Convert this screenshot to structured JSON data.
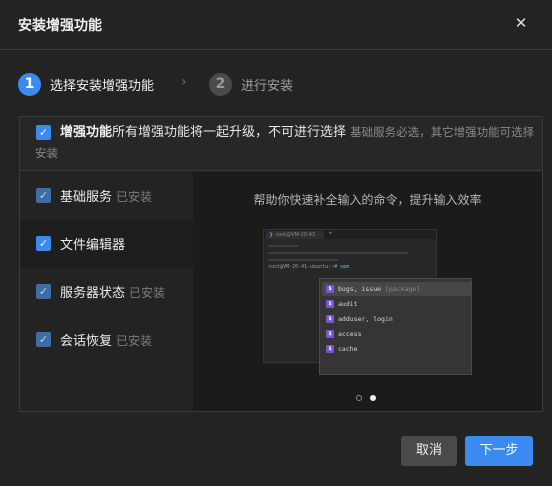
{
  "dialog": {
    "title": "安装增强功能",
    "close_glyph": "✕"
  },
  "steps": [
    {
      "number": "1",
      "label": "选择安装增强功能"
    },
    {
      "number": "2",
      "label": "进行安装"
    }
  ],
  "step_separator": "›",
  "panel": {
    "top": {
      "lead": "增强功能",
      "strong": "所有增强功能将一起升级，不可进行选择",
      "note": "基础服务必选，其它增强功能可选择安装"
    },
    "items": [
      {
        "label": "基础服务",
        "tag": "已安装"
      },
      {
        "label": "文件编辑器",
        "tag": ""
      },
      {
        "label": "服务器状态",
        "tag": "已安装"
      },
      {
        "label": "会话恢复",
        "tag": "已安装"
      }
    ],
    "preview": {
      "title": "帮助你快速补全输入的命令，提升输入效率",
      "tab_label": "root@VM-20-43",
      "plus": "+",
      "prompt": "root@VM-20-41-ubuntu:~#",
      "command": "npm",
      "suggestions": [
        {
          "text": "bugs, issue",
          "hint": "[package]"
        },
        {
          "text": "audit",
          "hint": ""
        },
        {
          "text": "adduser, login",
          "hint": ""
        },
        {
          "text": "access",
          "hint": ""
        },
        {
          "text": "cache",
          "hint": ""
        }
      ],
      "carousel": {
        "total": 2,
        "active": 2
      }
    }
  },
  "buttons": {
    "cancel": "取消",
    "next": "下一步"
  },
  "colors": {
    "accent": "#3a8af0",
    "background": "#232323"
  },
  "icons": {
    "check": "check-icon",
    "close": "close-icon",
    "separator": "chevron-right-icon"
  }
}
